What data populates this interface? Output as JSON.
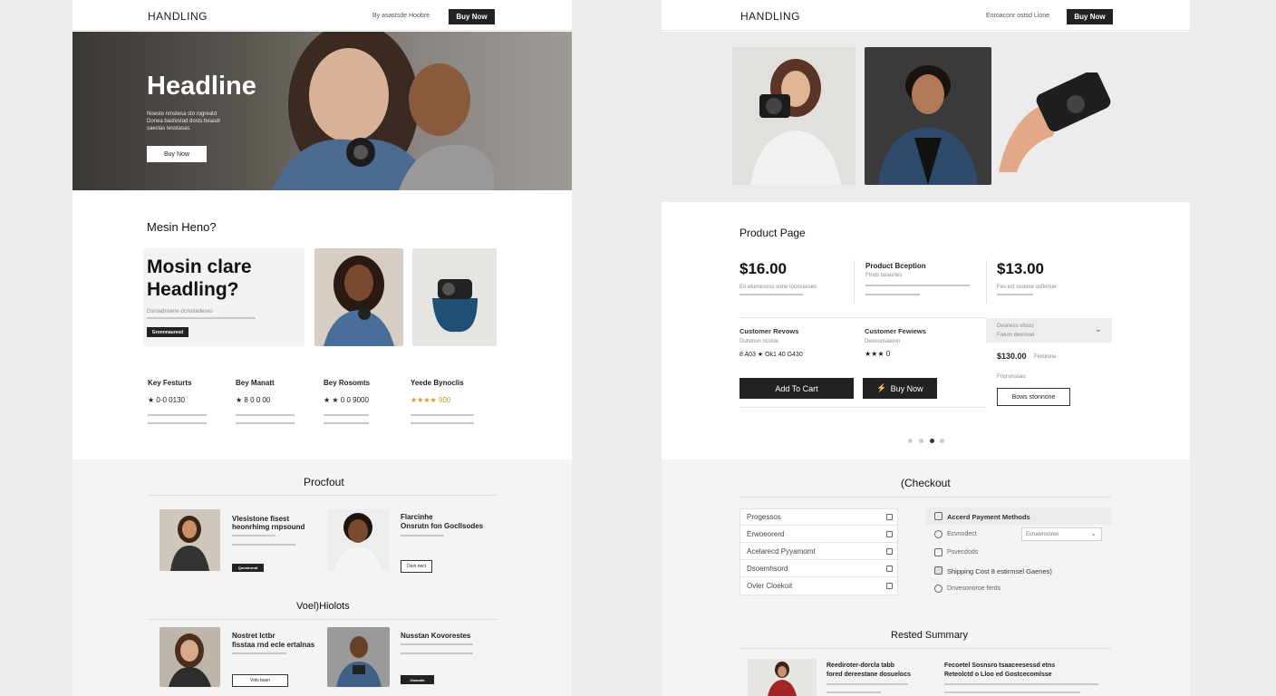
{
  "left": {
    "logo": "HANDLING",
    "nav_link": "By asastsde Hoobre",
    "nav_buy": "Buy Now",
    "hero": {
      "title": "Headline",
      "sub1": "Noeste nmstesa sto rogreatd",
      "sub2": "Donea basfestad dosts beasdr",
      "sub3": "saeclas tesstasas",
      "button": "Buy Now"
    },
    "section_title": "Mesin Heno?",
    "card": {
      "title1": "Mosin clare",
      "title2": "Headling?",
      "text": "Dsroadnsene dcmstadeses",
      "button": "Gronnnauresd"
    },
    "features": [
      {
        "title": "Key Festurts",
        "rating": "★ 0-0  0130"
      },
      {
        "title": "Bey Manatt",
        "rating": "★ 8  0 0  00"
      },
      {
        "title": "Bey Rosomts",
        "rating": "★ ★ 0 0  9000"
      },
      {
        "title": "Yeede Bynoclis",
        "rating": "★★★★ 900"
      }
    ],
    "procout": {
      "title": "Procfout",
      "items": [
        {
          "title1": "Vlesistone fisest",
          "title2": "heonrhimg rnpsound",
          "button": "Qonsturnat"
        },
        {
          "title1": "Flarcinhe",
          "title2": "Onsrutn fon Gocllsodes",
          "button": "Ouin nect"
        }
      ]
    },
    "voel": {
      "title": "Voel)Hiolots",
      "items": [
        {
          "title1": "Nostret Ictbr",
          "title2": "fisstaa rnd ecle ertalnas",
          "button": "Vnls basn"
        },
        {
          "title1": "Nusstan Kovorestes",
          "title2": "",
          "button": "Ganuafo"
        }
      ]
    }
  },
  "right": {
    "logo": "HANDLING",
    "nav_link": "Enroaconr ostsd Lione",
    "nav_buy": "Buy Now",
    "product_title": "Product Page",
    "price1": "$16.00",
    "price1_text": "Eo eturnesoss odne tocosseses",
    "desc_title": "Product Bception",
    "desc_sub": "Ftnds taraurtes",
    "price2": "$13.00",
    "price2_text": "Fes ezt osoone osfionoe",
    "reviews": [
      {
        "title": "Customer Revows",
        "sub": "Dutstnsn ncstoe",
        "rating": "8 A03  ★  Ok1 40 G430"
      },
      {
        "title": "Customer Fewiews",
        "sub": "Deoounsaeron",
        "rating": "★★★  0"
      }
    ],
    "dropdown_text1": "Deoness vlisoo",
    "dropdown_text2": "Foeon desnsoe",
    "price3": "$130.00",
    "price3_note": "Finiolone",
    "price3_sub": "Fnsrsnuoao",
    "btn_add": "Add To Cart",
    "btn_buy": "Buy Now",
    "btn_browse": "Bows stonnone",
    "checkout": {
      "title": "(Checkout",
      "rows": [
        "Progessos",
        "Erwoeorerd",
        "Acelarecd Pyyamomt",
        "Dsoemhsord",
        "Ovler Cloekoit"
      ],
      "options": [
        "Accerd Payment Methods",
        "Ecvnodect",
        "Psvecdods",
        "Shipping Cost 8 estirmsel Gaenes)",
        "Dnvesonoroe ferds"
      ],
      "select_value": "Ecnaivnsoreo"
    },
    "summary": {
      "title": "Rested Summary",
      "col1_title": "Reediroter-dorcla tabb",
      "col1_text": "fored dereestane dosuelocs",
      "col2_title": "Fecoetel Sosnsro tsaaceesessd etns",
      "col2_text": "Reteolctd o Lloo ed Gostcecomlsse"
    }
  },
  "colors": {
    "accent_dark": "#222222",
    "star_gold": "#c79b2e"
  }
}
